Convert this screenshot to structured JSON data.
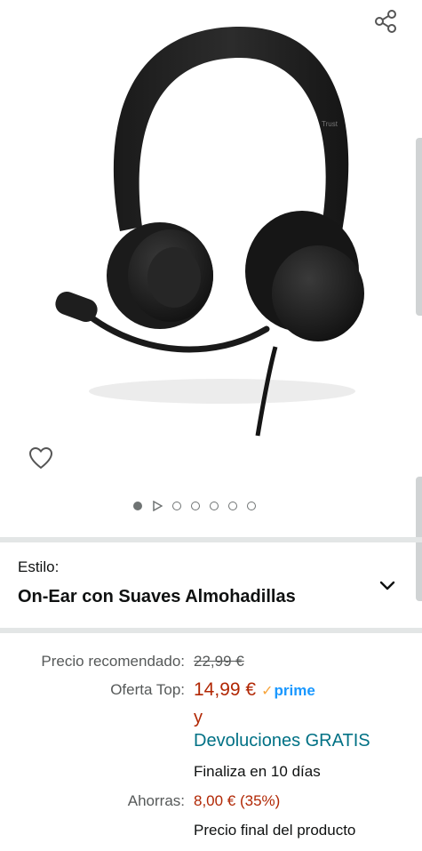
{
  "gallery": {
    "image_alt": "Trust On-Ear headset",
    "brand_mark": "Trust",
    "share_icon": "share-icon",
    "favorite_icon": "heart-icon",
    "indicators": [
      "image",
      "video",
      "image",
      "image",
      "image",
      "image",
      "image"
    ]
  },
  "style": {
    "label": "Estilo:",
    "value": "On-Ear con Suaves Almohadillas",
    "expand_icon": "chevron-down-icon"
  },
  "pricing": {
    "list_price_label": "Precio recomendado:",
    "list_price": "22,99 €",
    "deal_label": "Oferta Top:",
    "deal_price": "14,99 €",
    "prime_label": "prime",
    "and_text": "y",
    "returns_link": "Devoluciones GRATIS",
    "ends_text": "Finaliza en 10 días",
    "savings_label": "Ahorras:",
    "savings_value": "8,00 € (35%)",
    "final_price_note": "Precio final del producto"
  },
  "colors": {
    "deal": "#b12704",
    "link": "#007185",
    "prime": "#1a98ff",
    "divider": "#e3e6e6"
  }
}
